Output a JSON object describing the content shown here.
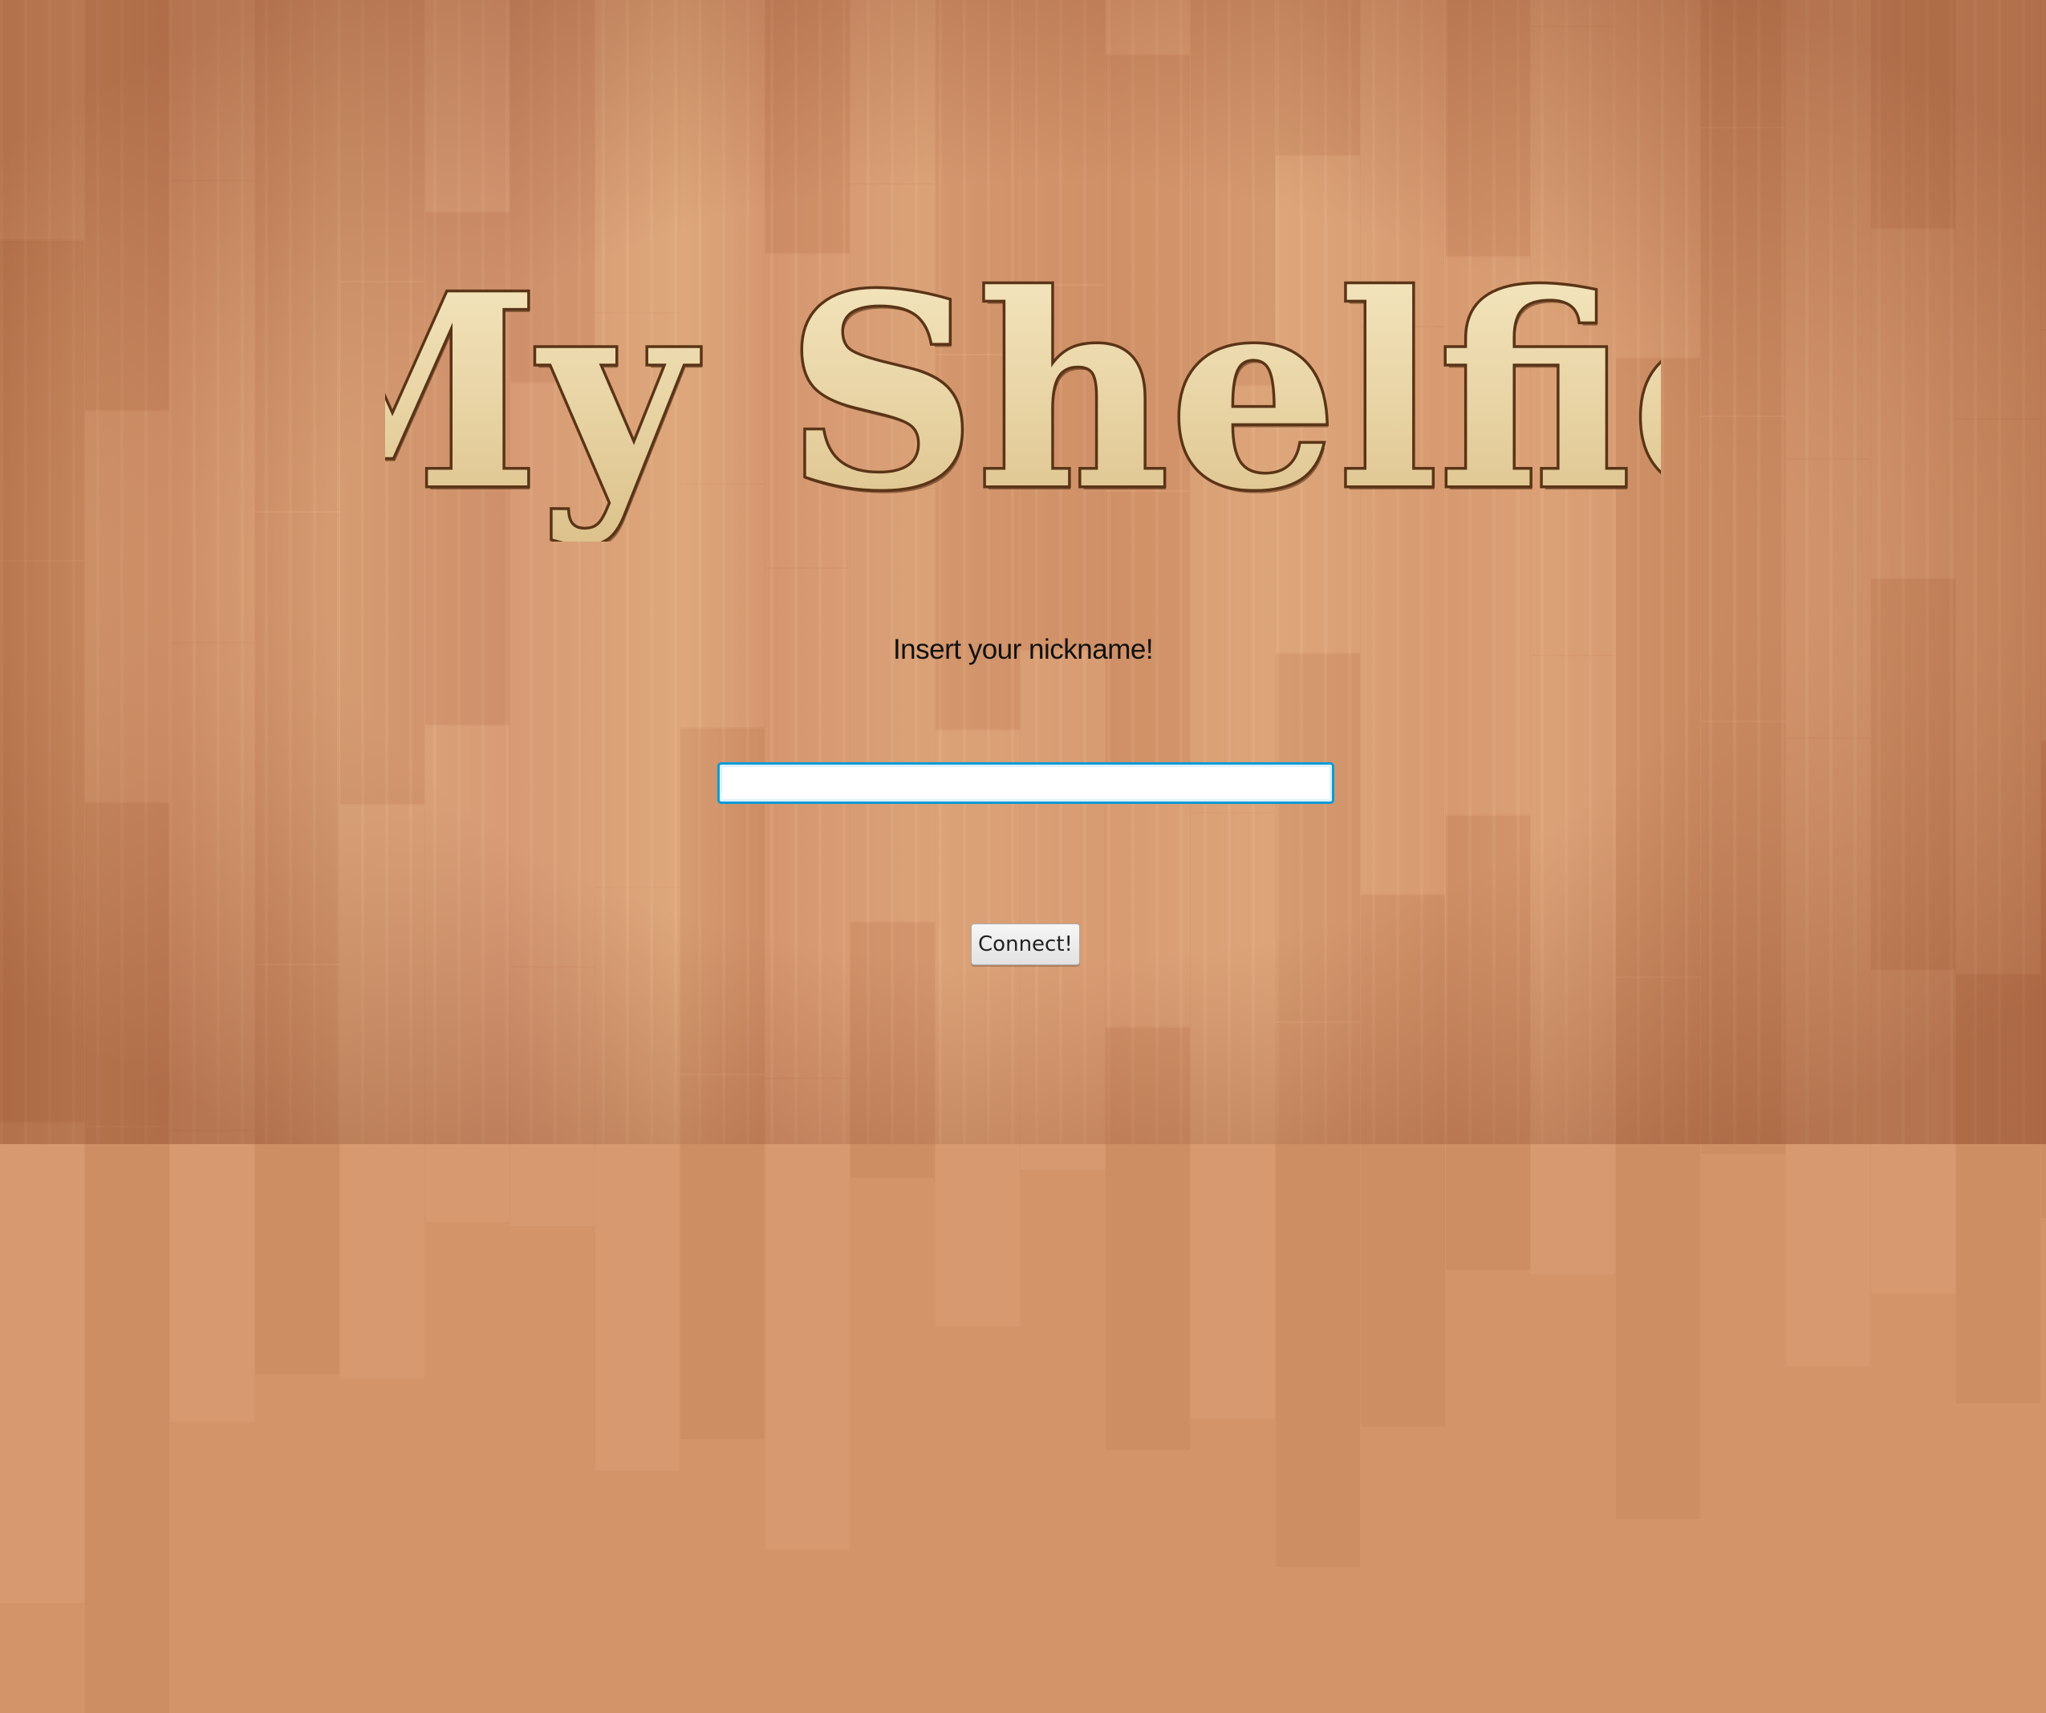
{
  "logo": {
    "text": "My Shelfie",
    "fill": "#f1dfb1",
    "outline": "#5a3416"
  },
  "login": {
    "prompt": "Insert your nickname!",
    "nickname_value": "",
    "connect_label": "Connect!"
  },
  "colors": {
    "background": "#d4946a",
    "input_focus": "#0a9bd6"
  }
}
